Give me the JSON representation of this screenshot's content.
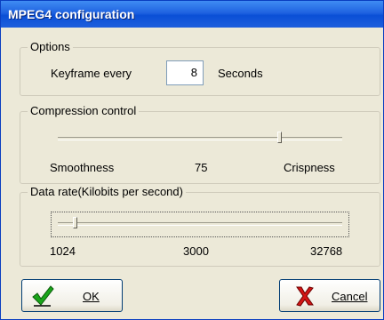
{
  "window": {
    "title": "MPEG4 configuration"
  },
  "options": {
    "legend": "Options",
    "keyframe_label": "Keyframe every",
    "keyframe_value": "8",
    "unit_label": "Seconds"
  },
  "compression": {
    "legend": "Compression control",
    "min_label": "Smoothness",
    "value_label": "75",
    "max_label": "Crispness",
    "slider_fraction": 0.78
  },
  "datarate": {
    "legend": "Data rate(Kilobits per second)",
    "min_label": "1024",
    "mid_label": "3000",
    "max_label": "32768",
    "slider_fraction": 0.06
  },
  "buttons": {
    "ok_label": "OK",
    "cancel_label": "Cancel",
    "ok_icon": "checkmark-icon",
    "cancel_icon": "red-x-icon"
  }
}
